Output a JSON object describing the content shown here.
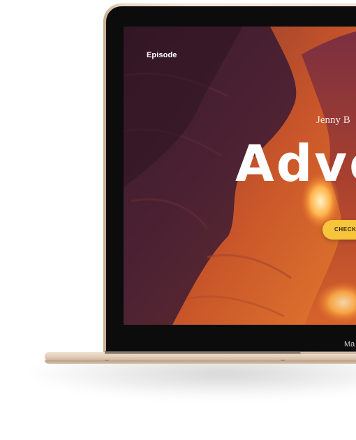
{
  "device": {
    "chin_brand": "Ma"
  },
  "screen": {
    "nav": {
      "episode_label": "Episode"
    },
    "hero": {
      "author": "Jenny B",
      "title": "Adve",
      "cta_label": "CHECK T"
    },
    "colors": {
      "cta_background": "#f6c53b",
      "device_finish": "#ecd9c6",
      "bezel": "#0c0c0d"
    }
  }
}
